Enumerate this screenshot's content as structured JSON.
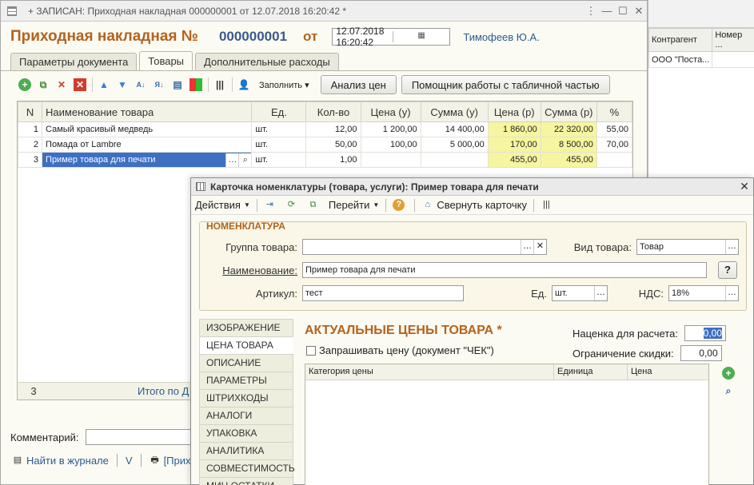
{
  "bg_window": {
    "columns": [
      "Контрагент",
      "Номер ..."
    ],
    "rows": [
      [
        "ООО \"Поста...",
        ""
      ]
    ]
  },
  "doc_window": {
    "title_bar": "+ ЗАПИСАН: Приходная накладная 000000001 от 12.07.2018 16:20:42 *",
    "header": {
      "title": "Приходная накладная №",
      "number": "000000001",
      "ot": "от",
      "date": "12.07.2018 16:20:42",
      "user": "Тимофеев Ю.А."
    },
    "tabs": [
      "Параметры документа",
      "Товары",
      "Дополнительные расходы"
    ],
    "toolbar": {
      "fill_label": "Заполнить",
      "analyze_label": "Анализ цен",
      "helper_label": "Помощник работы с табличной частью"
    },
    "grid": {
      "columns": [
        "N",
        "Наименование товара",
        "Ед.",
        "Кол-во",
        "Цена (у)",
        "Сумма (у)",
        "Цена (р)",
        "Сумма (р)",
        "%"
      ],
      "rows": [
        {
          "n": "1",
          "name": "Самый красивый медведь",
          "unit": "шт.",
          "qty": "12,00",
          "price_u": "1 200,00",
          "sum_u": "14 400,00",
          "price_r": "1 860,00",
          "sum_r": "22 320,00",
          "pct": "55,00"
        },
        {
          "n": "2",
          "name": "Помада от Lambre",
          "unit": "шт.",
          "qty": "50,00",
          "price_u": "100,00",
          "sum_u": "5 000,00",
          "price_r": "170,00",
          "sum_r": "8 500,00",
          "pct": "70,00"
        },
        {
          "n": "3",
          "name": "Пример товара для печати",
          "unit": "шт.",
          "qty": "1,00",
          "price_u": "",
          "sum_u": "",
          "price_r": "455,00",
          "sum_r": "455,00",
          "pct": ""
        }
      ],
      "footer_count": "3",
      "footer_total": "Итого по Д"
    },
    "comment_label": "Комментарий:",
    "bottom": {
      "journal": "Найти в журнале",
      "v": "V",
      "print": "[Прих"
    }
  },
  "card_window": {
    "title": "Карточка номенклатуры (товара, услуги): Пример товара для печати",
    "toolbar": {
      "actions": "Действия",
      "goto": "Перейти",
      "collapse": "Свернуть карточку"
    },
    "section_title": "НОМЕНКЛАТУРА",
    "fields": {
      "group_label": "Группа товара:",
      "group_value": "",
      "kind_label": "Вид товара:",
      "kind_value": "Товар",
      "name_label": "Наименование:",
      "name_value": "Пример товара для печати",
      "article_label": "Артикул:",
      "article_value": "тест",
      "unit_label": "Ед.",
      "unit_value": "шт.",
      "vat_label": "НДС:",
      "vat_value": "18%",
      "help": "?"
    },
    "side_tabs": [
      "ИЗОБРАЖЕНИЕ",
      "ЦЕНА ТОВАРА",
      "ОПИСАНИЕ",
      "ПАРАМЕТРЫ",
      "ШТРИХКОДЫ",
      "АНАЛОГИ",
      "УПАКОВКА",
      "АНАЛИТИКА",
      "СОВМЕСТИМОСТЬ",
      "МИН.ОСТАТКИ"
    ],
    "active_side_tab": 1,
    "prices": {
      "title": "АКТУАЛЬНЫЕ ЦЕНЫ ТОВАРА *",
      "markup_label": "Наценка для расчета:",
      "markup_value": "0,00",
      "limit_label": "Ограничение скидки:",
      "limit_value": "0,00",
      "ask_price_label": "Запрашивать цену (документ \"ЧЕК\")",
      "ask_price_checked": false,
      "columns": [
        "Категория цены",
        "Единица",
        "Цена"
      ]
    }
  }
}
